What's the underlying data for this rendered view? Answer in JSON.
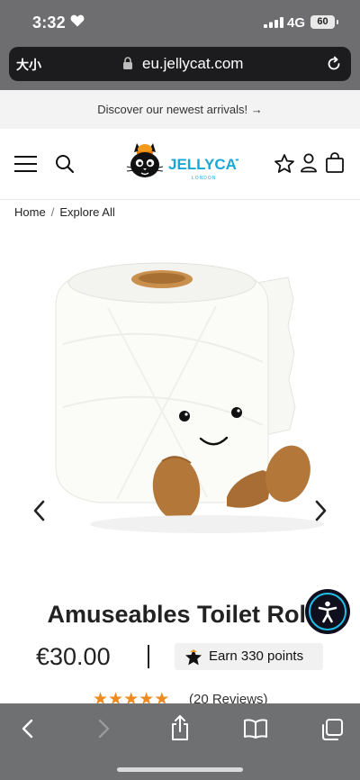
{
  "status_bar": {
    "time": "3:32",
    "network": "4G",
    "battery": "60"
  },
  "browser": {
    "text_size_label": "大小",
    "url": "eu.jellycat.com"
  },
  "promo": {
    "text": "Discover our newest arrivals! →"
  },
  "header": {
    "logo_text": "JELLYCAT",
    "logo_subtext": "LONDON"
  },
  "breadcrumb": {
    "items": [
      "Home",
      "Explore All"
    ]
  },
  "product": {
    "title": "Amuseables Toilet Roll",
    "price": "€30.00",
    "points_label": "Earn 330 points",
    "rating": 5,
    "reviews": "(20 Reviews)"
  },
  "colors": {
    "accent_star": "#f08a1f",
    "accessibility_ring": "#1ec0e8",
    "browser_chrome": "#6e6e70"
  },
  "icons": [
    "heart-icon",
    "signal-icon",
    "lock-icon",
    "reload-icon",
    "menu-icon",
    "search-icon",
    "wishlist-star-icon",
    "account-icon",
    "bag-icon",
    "chevron-left-icon",
    "chevron-right-icon",
    "accessibility-icon",
    "points-star-icon",
    "back-icon",
    "forward-icon",
    "share-icon",
    "bookmarks-icon",
    "tabs-icon"
  ]
}
